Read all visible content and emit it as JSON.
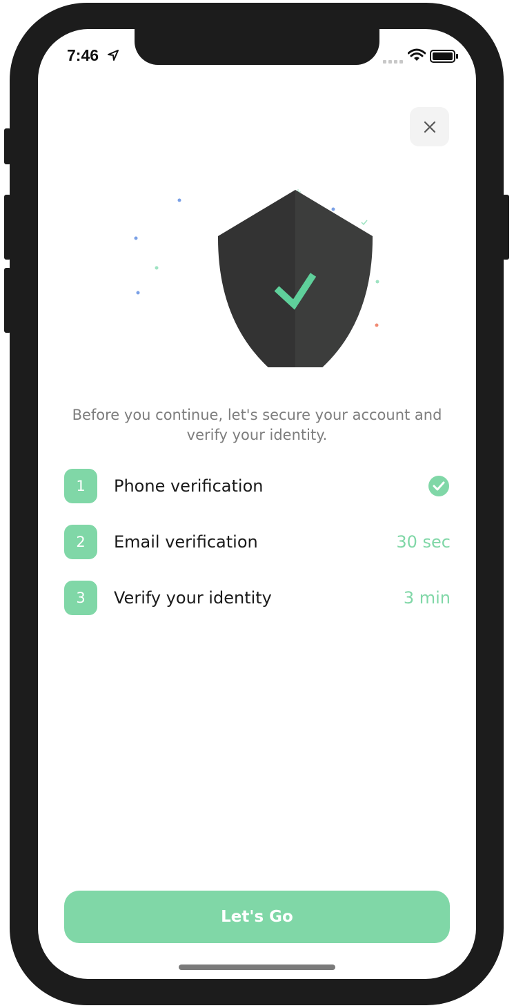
{
  "status_bar": {
    "time": "7:46",
    "icons": [
      "location-arrow-icon",
      "signal-icon",
      "wifi-icon",
      "battery-icon"
    ]
  },
  "close_icon": "close-icon",
  "illustration": {
    "icon": "shield-check-icon",
    "colors": {
      "shield_left": "#333333",
      "shield_right": "#3d3d3d",
      "check": "#5fd09b"
    }
  },
  "intro_text": "Before you continue, let's secure your account and verify your identity.",
  "steps": [
    {
      "number": "1",
      "label": "Phone verification",
      "status_icon": "check-circle-icon"
    },
    {
      "number": "2",
      "label": "Email verification",
      "meta": "30 sec"
    },
    {
      "number": "3",
      "label": "Verify your identity",
      "meta": "3 min"
    }
  ],
  "cta": {
    "label": "Let's Go"
  },
  "colors": {
    "accent": "#80d7a7",
    "frame": "#1c1c1c",
    "muted_text": "#7d7d7d"
  }
}
